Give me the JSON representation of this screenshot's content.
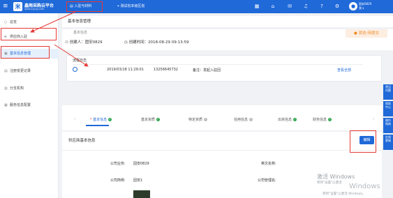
{
  "header": {
    "menu_glyph": "≡",
    "logo_glyph": "米",
    "brand": "鑫雨采购云平台",
    "brand_sub": "www.xyycg.com",
    "nav_tab": "入驻与材料",
    "location": "测试省本级区划",
    "user_name": "固安0829",
    "user_sub": "我 ▾"
  },
  "sidebar": {
    "items": [
      {
        "icon": "○",
        "label": "总览"
      },
      {
        "icon": "⎆",
        "label": "供应商入驻"
      },
      {
        "icon": "▣",
        "label": "基本信息管理"
      },
      {
        "icon": "▤",
        "label": "注册变更记录"
      },
      {
        "icon": "▥",
        "label": "分支机构"
      },
      {
        "icon": "▦",
        "label": "服务信息配置"
      }
    ]
  },
  "breadcrumb": {
    "title": "基本信息管理"
  },
  "summary": {
    "status_label": "状态:待提交",
    "subtitle": "基本信息",
    "creator": "创建人：固安0829",
    "created_time": "创建时间：2018-08-29 09:13:59"
  },
  "log": {
    "title": "流程日志",
    "time": "2019/03/18 11:29:01",
    "phone": "13256645732",
    "note": "备注：发起入驻回",
    "view_all": "查看全部"
  },
  "steps": [
    {
      "label": "基本信息",
      "done": true
    },
    {
      "label": "基本资质",
      "done": true
    },
    {
      "label": "特定资质",
      "done": false
    },
    {
      "label": "信用信息",
      "done": false
    },
    {
      "label": "出资信息",
      "done": true
    },
    {
      "label": "财务信息",
      "done": true
    }
  ],
  "detail": {
    "title": "供应商基本信息",
    "edit_button": "编辑",
    "company_account_label": "公司业务:",
    "company_account_value": "固安0829",
    "english_name_label": "英文名称:",
    "company_short_label": "公司简称:",
    "company_short_value": "固安1",
    "company_manage_label": "公司管理名:"
  },
  "float_tabs": [
    "常见\n问题",
    "帮助\n中心",
    "操作\n指南",
    "在线\n客服"
  ],
  "watermark": {
    "line1": "激活 Windows",
    "line2": "转到\"设置\"以激活",
    "line3": "Windows",
    "line4": "转到\"设置\"以激活 Windows。"
  }
}
